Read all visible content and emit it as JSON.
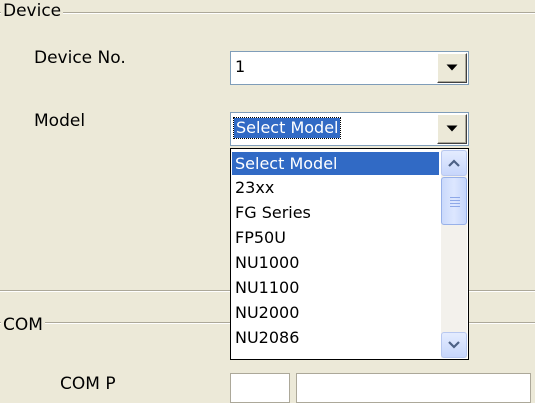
{
  "device_group": {
    "legend": "Device",
    "device_no_label": "Device No.",
    "device_no_value": "1",
    "model_label": "Model",
    "model_value": "Select Model"
  },
  "model_dropdown": {
    "items": [
      {
        "label": "Select Model",
        "selected": true
      },
      {
        "label": "23xx"
      },
      {
        "label": "FG Series"
      },
      {
        "label": "FP50U"
      },
      {
        "label": "NU1000"
      },
      {
        "label": "NU1100"
      },
      {
        "label": "NU2000"
      },
      {
        "label": "NU2086"
      }
    ]
  },
  "com_group": {
    "legend": "COM",
    "partial_label": "COM P"
  },
  "colors": {
    "window_bg": "#ece9d8",
    "selection": "#316ac5",
    "field_border": "#7f9db9"
  }
}
